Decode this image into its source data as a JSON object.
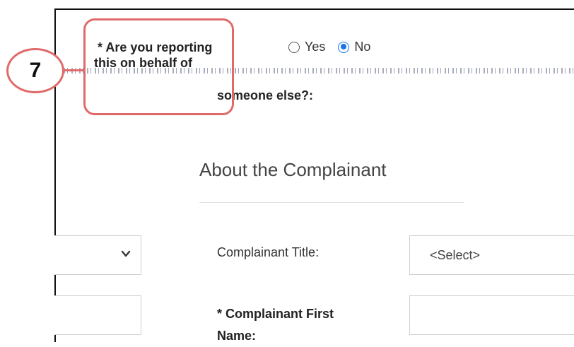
{
  "step_badge": "7",
  "question": {
    "line1": "* Are you reporting",
    "line2": "this on behalf of",
    "line3": "someone else?:"
  },
  "radio": {
    "options": [
      "Yes",
      "No"
    ],
    "selected": "No"
  },
  "section": {
    "title": "About the Complainant"
  },
  "fields": {
    "title_label": "Complainant Title:",
    "title_value": "<Select>",
    "first_name_label_1": "* Complainant First",
    "first_name_label_2": "Name:"
  },
  "colors": {
    "callout": "#e06a6a",
    "radio_accent": "#1a73e8"
  }
}
